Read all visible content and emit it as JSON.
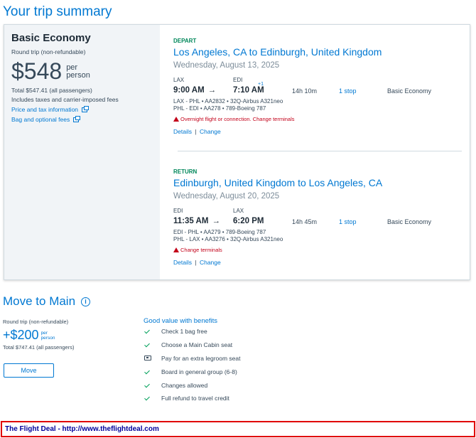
{
  "page": {
    "title": "Your trip summary"
  },
  "fare": {
    "name": "Basic Economy",
    "subtitle": "Round trip (non-refundable)",
    "price": "$548",
    "per_line1": "per",
    "per_line2": "person",
    "total": "Total $547.41 (all passengers)",
    "includes": "Includes taxes and carrier-imposed fees",
    "price_tax_link": "Price and tax information",
    "bag_link": "Bag and optional fees"
  },
  "segments": [
    {
      "label": "DEPART",
      "route": "Los Angeles, CA to Edinburgh, United Kingdom",
      "date": "Wednesday, August 13, 2025",
      "from_code": "LAX",
      "to_code": "EDI",
      "dep_time": "9:00 AM",
      "arrow": "→",
      "arr_time": "7:10 AM",
      "day_offset": "+1",
      "duration": "14h 10m",
      "stops": "1 stop",
      "cabin": "Basic Economy",
      "flights": [
        "LAX - PHL • AA2832 • 32Q-Airbus A321neo",
        "PHL - EDI • AA278 • 789-Boeing 787"
      ],
      "warning": "Overnight flight or connection. Change terminals",
      "details_link": "Details",
      "separator": "|",
      "change_link": "Change"
    },
    {
      "label": "RETURN",
      "route": "Edinburgh, United Kingdom to Los Angeles, CA",
      "date": "Wednesday, August 20, 2025",
      "from_code": "EDI",
      "to_code": "LAX",
      "dep_time": "11:35 AM",
      "arrow": "→",
      "arr_time": "6:20 PM",
      "duration": "14h 45m",
      "stops": "1 stop",
      "cabin": "Basic Economy",
      "flights": [
        "EDI - PHL • AA279 • 789-Boeing 787",
        "PHL - LAX • AA3276 • 32Q-Airbus A321neo"
      ],
      "warning": "Change terminals",
      "details_link": "Details",
      "separator": "|",
      "change_link": "Change"
    }
  ],
  "move_to_main": {
    "title": "Move to Main",
    "info_glyph": "i",
    "subtitle": "Round trip (non-refundable)",
    "price": "+$200",
    "per_line1": "per",
    "per_line2": "person",
    "total": "Total $747.41 (all passengers)",
    "button_label": "Move",
    "benefits_title": "Good value with benefits",
    "benefits": [
      {
        "icon": "check-icon",
        "text": "Check 1 bag free"
      },
      {
        "icon": "check-icon",
        "text": "Choose a Main Cabin seat"
      },
      {
        "icon": "seat-icon",
        "text": "Pay for an extra legroom seat"
      },
      {
        "icon": "check-icon",
        "text": "Board in general group (6-8)"
      },
      {
        "icon": "check-icon",
        "text": "Changes allowed"
      },
      {
        "icon": "check-icon",
        "text": "Full refund to travel credit"
      }
    ]
  },
  "footer": {
    "text": "The Flight Deal - http://www.theflightdeal.com"
  },
  "colors": {
    "accent": "#0078d2",
    "success": "#00875a",
    "warning": "#c30019",
    "footer_border": "#e00000",
    "footer_text": "#00009c"
  }
}
